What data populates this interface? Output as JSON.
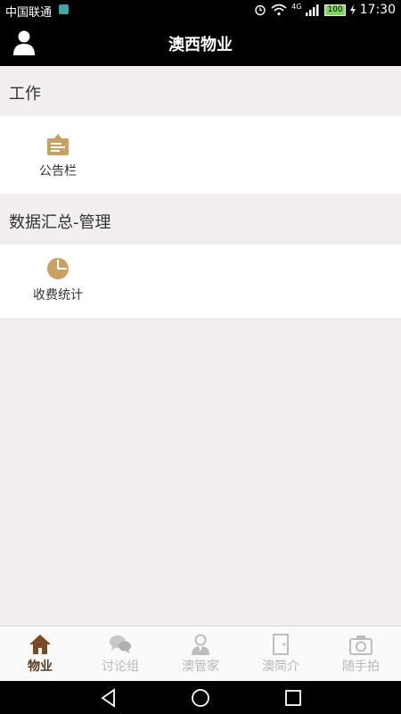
{
  "status_bar": {
    "carrier": "中国联通",
    "network": "4G",
    "battery": "100",
    "time": "17:30"
  },
  "app_bar": {
    "title": "澳西物业"
  },
  "sections": [
    {
      "title": "工作",
      "items": [
        {
          "label": "公告栏",
          "icon": "bulletin-board-icon"
        }
      ]
    },
    {
      "title": "数据汇总-管理",
      "items": [
        {
          "label": "收费统计",
          "icon": "pie-chart-icon"
        }
      ]
    }
  ],
  "tabs": [
    {
      "label": "物业",
      "icon": "home-icon",
      "active": true
    },
    {
      "label": "讨论组",
      "icon": "chat-bubbles-icon"
    },
    {
      "label": "澳管家",
      "icon": "butler-icon"
    },
    {
      "label": "澳简介",
      "icon": "door-icon"
    },
    {
      "label": "随手拍",
      "icon": "camera-icon"
    }
  ],
  "colors": {
    "accent": "#c9a263",
    "active_tab": "#5a3a1d",
    "inactive_tab": "#b8b8b8",
    "bar": "#000000",
    "background": "#f1f0ee"
  },
  "nav_buttons": [
    "back-icon",
    "home-circle-icon",
    "recents-icon"
  ]
}
